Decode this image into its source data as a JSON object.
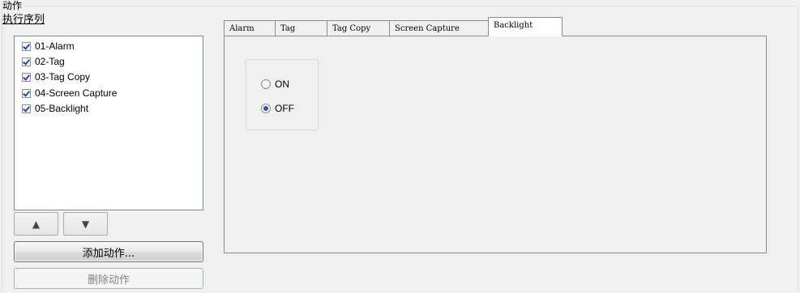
{
  "group": {
    "title": "动作"
  },
  "sequence": {
    "label": "执行序列",
    "items": [
      {
        "label": "01-Alarm",
        "checked": true
      },
      {
        "label": "02-Tag",
        "checked": true
      },
      {
        "label": "03-Tag Copy",
        "checked": true
      },
      {
        "label": "04-Screen Capture",
        "checked": true
      },
      {
        "label": "05-Backlight",
        "checked": true
      }
    ]
  },
  "buttons": {
    "up_icon": "triangle-up-icon",
    "up_glyph": "▲",
    "down_icon": "triangle-down-icon",
    "down_glyph": "▼",
    "add": "添加动作...",
    "delete": "删除动作"
  },
  "tabs": [
    {
      "label": "Alarm"
    },
    {
      "label": "Tag"
    },
    {
      "label": "Tag Copy"
    },
    {
      "label": "Screen Capture"
    },
    {
      "label": "Backlight",
      "active": true
    }
  ],
  "backlight": {
    "options": [
      {
        "label": "ON",
        "selected": false
      },
      {
        "label": "OFF",
        "selected": true
      }
    ]
  },
  "colors": {
    "checkmark": "#2b4f9b",
    "radio_selected": "#2a56a8",
    "border": "#898c95"
  }
}
